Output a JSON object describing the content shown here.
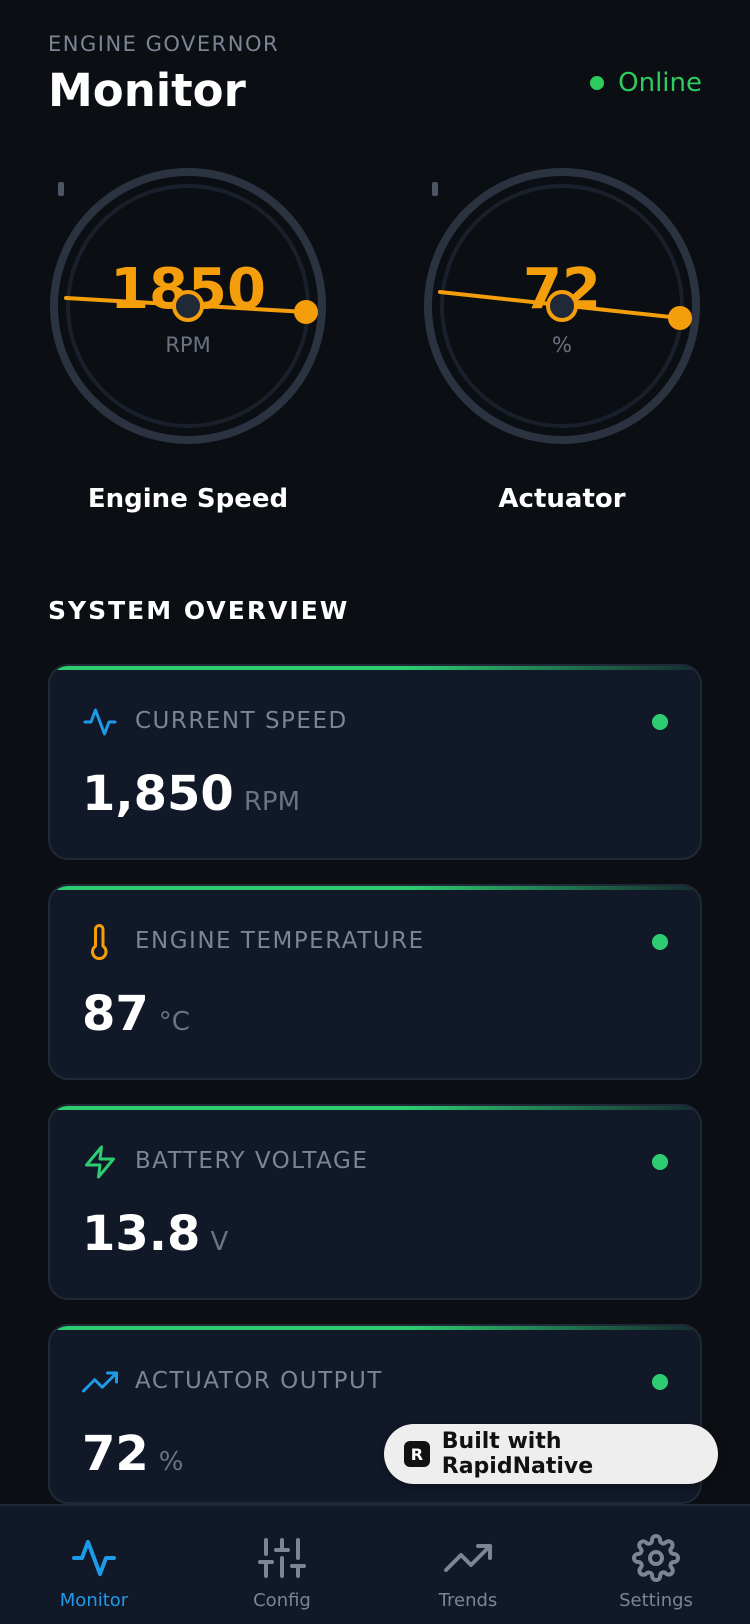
{
  "header": {
    "subtitle": "ENGINE GOVERNOR",
    "title": "Monitor",
    "status": "Online"
  },
  "gauges": [
    {
      "value": "1850",
      "unit": "RPM",
      "label": "Engine Speed",
      "level": 0.53
    },
    {
      "value": "72",
      "unit": "%",
      "label": "Actuator",
      "level": 0.72
    }
  ],
  "section_title": "SYSTEM OVERVIEW",
  "cards": [
    {
      "label": "CURRENT SPEED",
      "value": "1,850",
      "unit": "RPM",
      "icon": "activity-icon",
      "icon_color": "#1e9be8"
    },
    {
      "label": "ENGINE TEMPERATURE",
      "value": "87",
      "unit": "°C",
      "icon": "thermometer-icon",
      "icon_color": "#f59e0b"
    },
    {
      "label": "BATTERY VOLTAGE",
      "value": "13.8",
      "unit": "V",
      "icon": "zap-icon",
      "icon_color": "#2ecc71"
    },
    {
      "label": "ACTUATOR OUTPUT",
      "value": "72",
      "unit": "%",
      "icon": "trending-up-icon",
      "icon_color": "#1e9be8"
    }
  ],
  "badge": {
    "text": "Built with RapidNative",
    "logo": "R"
  },
  "tabs": [
    {
      "label": "Monitor",
      "icon": "activity-icon",
      "active": true
    },
    {
      "label": "Config",
      "icon": "sliders-icon",
      "active": false
    },
    {
      "label": "Trends",
      "icon": "trending-up-icon",
      "active": false
    },
    {
      "label": "Settings",
      "icon": "gear-icon",
      "active": false
    }
  ],
  "colors": {
    "accent_orange": "#f59e0b",
    "accent_blue": "#1e9be8",
    "status_green": "#2ecc71",
    "background": "#0b0e13",
    "card": "#111827"
  }
}
